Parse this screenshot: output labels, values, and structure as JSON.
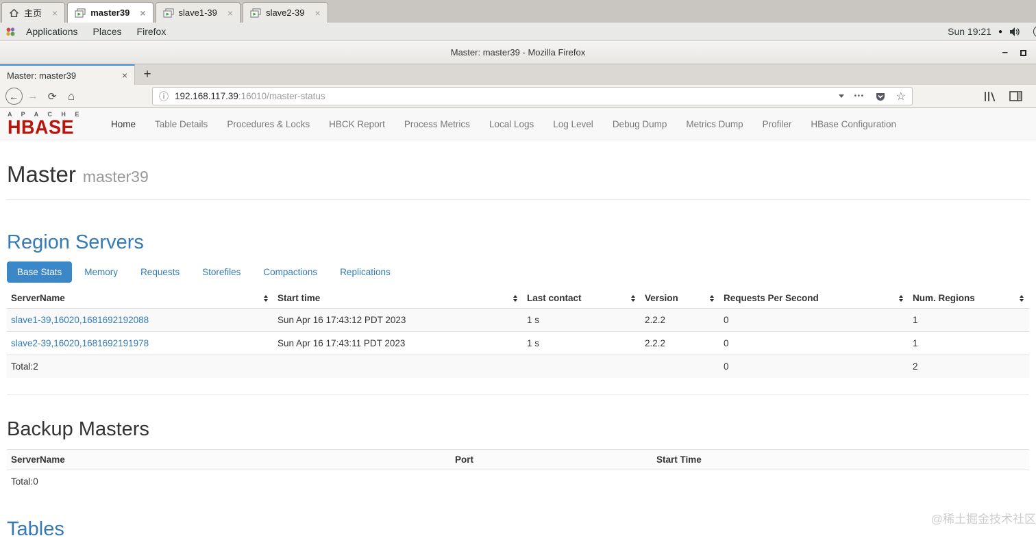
{
  "glyphs": {
    "close": "×",
    "new_tab": "+",
    "minimize": "–",
    "back": "←",
    "forward": "→",
    "reload": "⟳",
    "home": "⌂",
    "info": "ⓘ",
    "dots": "•••",
    "star": "☆",
    "record": "●"
  },
  "host_tabs": {
    "tabs": [
      {
        "label": "主页"
      },
      {
        "label": "master39"
      },
      {
        "label": "slave1-39"
      },
      {
        "label": "slave2-39"
      }
    ]
  },
  "desktop_panel": {
    "menus": [
      "Applications",
      "Places",
      "Firefox"
    ],
    "clock": "Sun 19:21"
  },
  "firefox": {
    "window_title": "Master: master39 - Mozilla Firefox",
    "tab_title": "Master: master39",
    "url": {
      "host": "192.168.117.39",
      "path": ":16010/master-status"
    }
  },
  "hbase": {
    "logo": {
      "top": "A P A C H E",
      "main": "HBASE"
    },
    "nav": [
      "Home",
      "Table Details",
      "Procedures & Locks",
      "HBCK Report",
      "Process Metrics",
      "Local Logs",
      "Log Level",
      "Debug Dump",
      "Metrics Dump",
      "Profiler",
      "HBase Configuration"
    ],
    "page_title": "Master",
    "page_subtitle": "master39",
    "region_servers": {
      "heading": "Region Servers",
      "tabs": [
        "Base Stats",
        "Memory",
        "Requests",
        "Storefiles",
        "Compactions",
        "Replications"
      ],
      "active_tab": "Base Stats",
      "table": {
        "columns": [
          "ServerName",
          "Start time",
          "Last contact",
          "Version",
          "Requests Per Second",
          "Num. Regions"
        ],
        "rows": [
          [
            "slave1-39,16020,1681692192088",
            "Sun Apr 16 17:43:12 PDT 2023",
            "1 s",
            "2.2.2",
            "0",
            "1"
          ],
          [
            "slave2-39,16020,1681692191978",
            "Sun Apr 16 17:43:11 PDT 2023",
            "1 s",
            "2.2.2",
            "0",
            "1"
          ]
        ],
        "total_row": [
          "Total:2",
          "",
          "",
          "",
          "0",
          "2"
        ]
      }
    },
    "backup_masters": {
      "heading": "Backup Masters",
      "columns": [
        "ServerName",
        "Port",
        "Start Time"
      ],
      "total": "Total:0"
    },
    "tables_heading": "Tables"
  },
  "watermark": "@稀土掘金技术社区",
  "colors": {
    "accent_blue": "#337ab7",
    "pill_blue": "#3c87c8",
    "hbase_red": "#b9150b",
    "ff_tab_accent": "#4a90d9",
    "stripe": "#f9f9f9"
  }
}
